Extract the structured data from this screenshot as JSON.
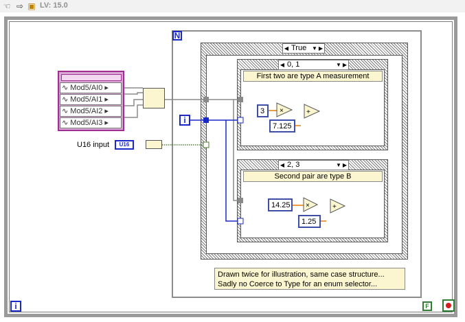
{
  "toolbar": {
    "version": "LV: 15.0",
    "icons": [
      "hand-icon",
      "run-arrow-icon",
      "labview-icon"
    ]
  },
  "while_loop": {
    "iteration_label": "i",
    "condition_label": "F",
    "stop_icon": "stop-icon"
  },
  "for_loop": {
    "count_label": "N",
    "iteration_label": "i"
  },
  "outer_case": {
    "selector": "True"
  },
  "case_a": {
    "selector": "0, 1",
    "label": "First two are type A measurement",
    "constants": [
      "3",
      "7.125"
    ]
  },
  "case_b": {
    "selector": "2, 3",
    "label": "Second pair are type B",
    "constants": [
      "14.25",
      "1.25"
    ]
  },
  "channels": [
    "Mod5/AI0",
    "Mod5/AI1",
    "Mod5/AI2",
    "Mod5/AI3"
  ],
  "u16_input": {
    "label": "U16 input",
    "terminal": "U16"
  },
  "comment": {
    "line1": "Drawn twice for illustration, same case structure...",
    "line2": "Sadly no Coerce to Type for an enum selector..."
  },
  "colors": {
    "wire_blue": "#1a28c8",
    "wire_gray": "#8a8a8a",
    "wire_green": "#4a7a32",
    "cluster": "#a12c94",
    "frame": "#9a9a9a"
  }
}
